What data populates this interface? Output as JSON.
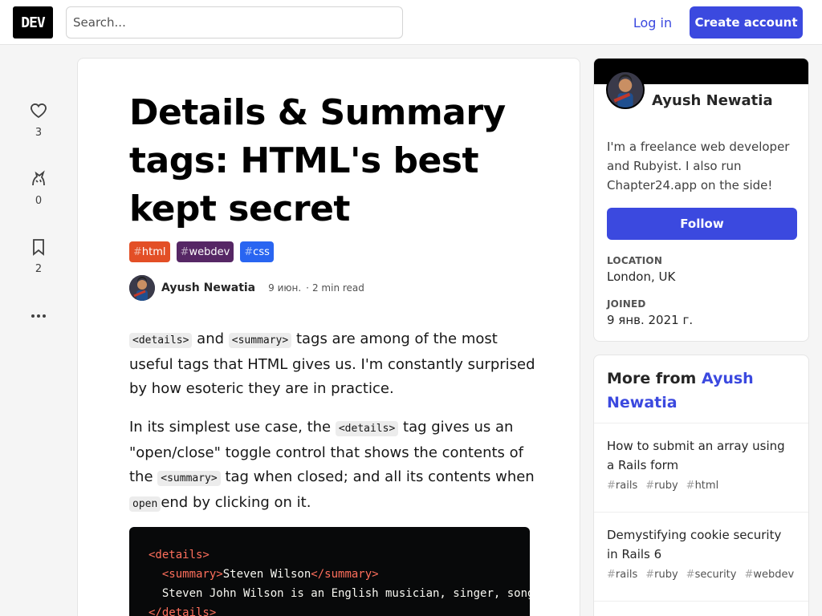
{
  "header": {
    "logo": "DEV",
    "search_placeholder": "Search...",
    "login": "Log in",
    "create_account": "Create account"
  },
  "reactions": [
    {
      "icon": "heart-icon",
      "count": "3"
    },
    {
      "icon": "unicorn-icon",
      "count": "0"
    },
    {
      "icon": "bookmark-icon",
      "count": "2"
    },
    {
      "icon": "more-icon",
      "count": ""
    }
  ],
  "article": {
    "title": "Details & Summary tags: HTML's best kept secret",
    "tags": [
      {
        "name": "html",
        "color": "#e34f26"
      },
      {
        "name": "webdev",
        "color": "#562765"
      },
      {
        "name": "css",
        "color": "#2965f1"
      }
    ],
    "author": "Ayush Newatia",
    "date": "9 июн.",
    "read_time": "2 min read",
    "p1": {
      "code1": "<details>",
      "t1": " and ",
      "code2": "<summary>",
      "t2": " tags are among of the most useful tags that HTML gives us. I'm constantly surprised by how esoteric they are in practice."
    },
    "p2": {
      "t1": "In its simplest use case, the ",
      "code1": "<details>",
      "t2": " tag gives us an \"open/close\" toggle control that shows the contents of the ",
      "code2": "<summary>",
      "t3": " tag when closed; and all its contents when ",
      "code3": "open",
      "t4": "end by clicking on it."
    },
    "code": {
      "l1": "<details>",
      "l2_open": "<summary>",
      "l2_text": "Steven Wilson",
      "l2_close": "</summary>",
      "l3": "Steven John Wilson is an English musician, singer, songwriter",
      "l4": "</details>"
    }
  },
  "author_card": {
    "name": "Ayush Newatia",
    "bio": "I'm a freelance web developer and Rubyist. I also run Chapter24.app on the side!",
    "follow": "Follow",
    "location_label": "LOCATION",
    "location": "London, UK",
    "joined_label": "JOINED",
    "joined": "9 янв. 2021 г."
  },
  "more_from": {
    "prefix": "More from ",
    "author": "Ayush Newatia",
    "items": [
      {
        "title": "How to submit an array using a Rails form",
        "tags": [
          "rails",
          "ruby",
          "html"
        ]
      },
      {
        "title": "Demystifying cookie security in Rails 6",
        "tags": [
          "rails",
          "ruby",
          "security",
          "webdev"
        ]
      }
    ]
  },
  "colors": {
    "accent": "#3b49df",
    "code_bg": "#08090a",
    "code_tag": "#ff6f5c"
  }
}
